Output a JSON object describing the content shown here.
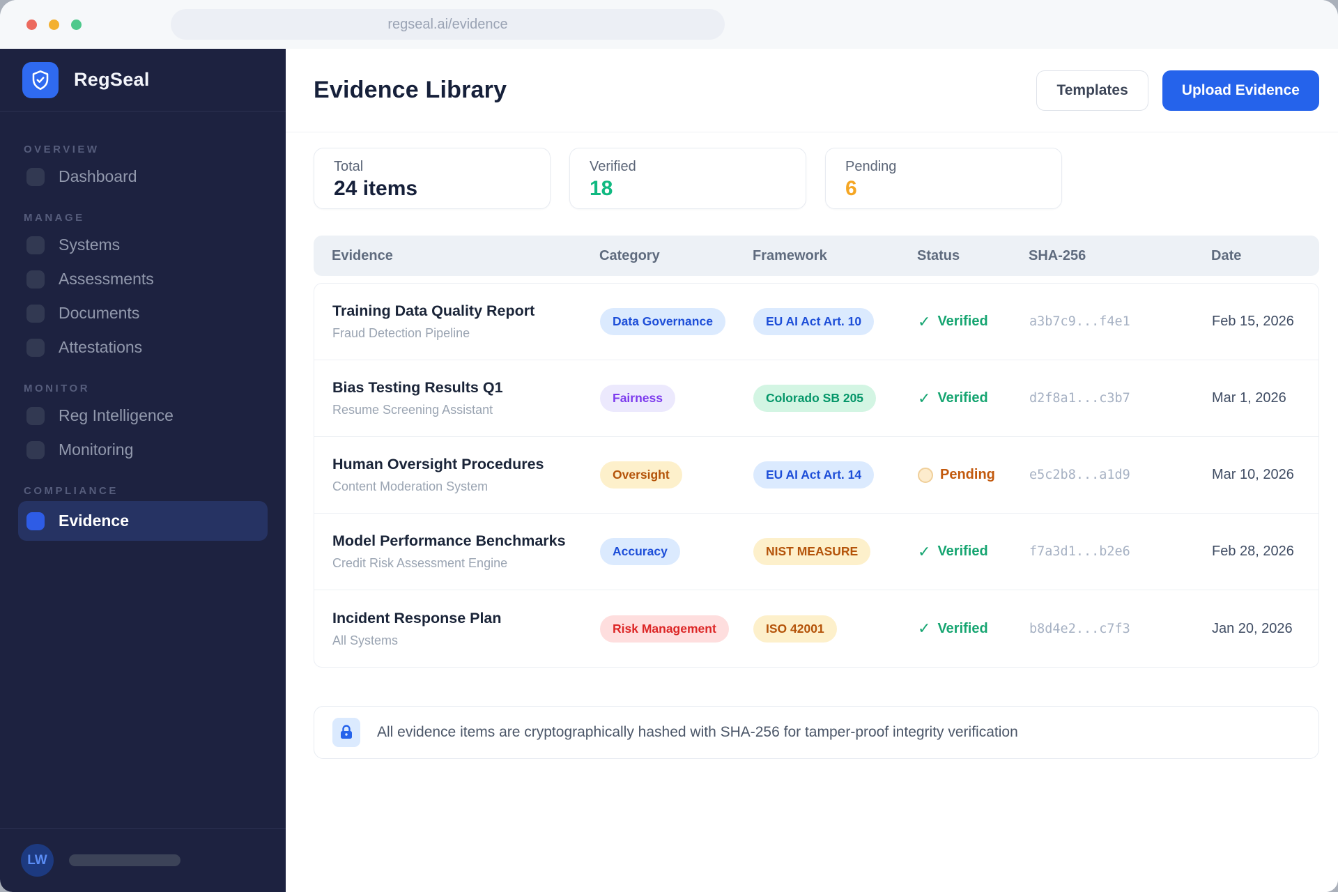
{
  "browser": {
    "url": "regseal.ai/evidence"
  },
  "colors": {
    "accent_blue": "#2563eb",
    "verified_green": "#10b981",
    "pending_amber": "#f59e0b",
    "sidebar_bg": "#1d2240"
  },
  "icons": {
    "check": "✓"
  },
  "sidebar": {
    "brand": "RegSeal",
    "user_initials": "LW",
    "sections": [
      {
        "label": "OVERVIEW",
        "items": [
          {
            "label": "Dashboard"
          }
        ]
      },
      {
        "label": "MANAGE",
        "items": [
          {
            "label": "Systems"
          },
          {
            "label": "Assessments"
          },
          {
            "label": "Documents"
          },
          {
            "label": "Attestations"
          }
        ]
      },
      {
        "label": "MONITOR",
        "items": [
          {
            "label": "Reg Intelligence"
          },
          {
            "label": "Monitoring"
          }
        ]
      },
      {
        "label": "COMPLIANCE",
        "items": [
          {
            "label": "Evidence",
            "active": true
          }
        ]
      }
    ]
  },
  "header": {
    "title": "Evidence Library",
    "templates_label": "Templates",
    "upload_label": "Upload Evidence"
  },
  "stats": [
    {
      "label": "Total",
      "value": "24 items"
    },
    {
      "label": "Verified",
      "value": "18"
    },
    {
      "label": "Pending",
      "value": "6"
    }
  ],
  "table": {
    "columns": [
      "Evidence",
      "Category",
      "Framework",
      "Status",
      "SHA-256",
      "Date"
    ],
    "rows": [
      {
        "name": "Training Data Quality Report",
        "system": "Fraud Detection Pipeline",
        "category": "Data Governance",
        "framework": "EU AI Act Art. 10",
        "status": "Verified",
        "sha": "a3b7c9...f4e1",
        "date": "Feb 15, 2026"
      },
      {
        "name": "Bias Testing Results Q1",
        "system": "Resume Screening Assistant",
        "category": "Fairness",
        "framework": "Colorado SB 205",
        "status": "Verified",
        "sha": "d2f8a1...c3b7",
        "date": "Mar 1, 2026"
      },
      {
        "name": "Human Oversight Procedures",
        "system": "Content Moderation System",
        "category": "Oversight",
        "framework": "EU AI Act Art. 14",
        "status": "Pending",
        "sha": "e5c2b8...a1d9",
        "date": "Mar 10, 2026"
      },
      {
        "name": "Model Performance Benchmarks",
        "system": "Credit Risk Assessment Engine",
        "category": "Accuracy",
        "framework": "NIST MEASURE",
        "status": "Verified",
        "sha": "f7a3d1...b2e6",
        "date": "Feb 28, 2026"
      },
      {
        "name": "Incident Response Plan",
        "system": "All Systems",
        "category": "Risk Management",
        "framework": "ISO 42001",
        "status": "Verified",
        "sha": "b8d4e2...c7f3",
        "date": "Jan 20, 2026"
      }
    ]
  },
  "note": "All evidence items are cryptographically hashed with SHA-256 for tamper-proof integrity verification"
}
